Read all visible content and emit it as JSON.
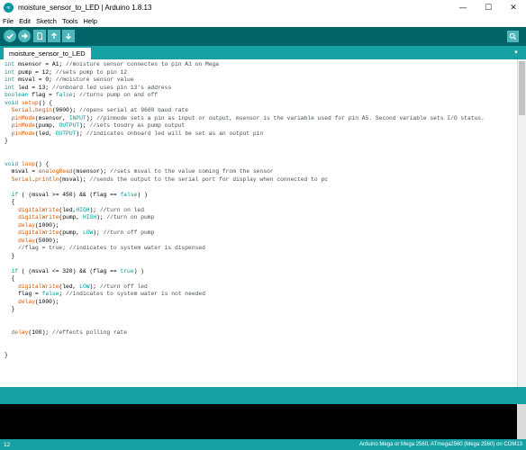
{
  "window": {
    "title": "moisture_sensor_to_LED | Arduino 1.8.13",
    "app_icon_glyph": "∞",
    "controls": {
      "minimize": "—",
      "maximize": "☐",
      "close": "✕"
    }
  },
  "menu": [
    "File",
    "Edit",
    "Sketch",
    "Tools",
    "Help"
  ],
  "toolbar": {
    "buttons": [
      "verify-icon",
      "upload-icon",
      "new-icon",
      "open-icon",
      "save-icon"
    ],
    "serial_monitor_icon": "magnifier-icon"
  },
  "tabs": {
    "active": "moisture_sensor_to_LED",
    "menu_glyph": "▾"
  },
  "code": [
    "int msensor = A1; //moisture sensor connectes to pin A1 on Mega",
    "int pump = 12; //sets pump to pin 12",
    "int msval = 0; //moisture sensor value",
    "int led = 13; //onboard led uses pin 13's address",
    "boolean flag = false; //turns pump on and off",
    "void setup() {",
    "  Serial.begin(9600); //opens serial at 9600 baud rate",
    "  pinMode(msensor, INPUT); //pinmode sets a pin as input or output, msensor is the variable used for pin A5. Second variable sets I/O status.",
    "  pinMode(pump, OUTPUT); //sets toodry as pump output",
    "  pinMode(led, OUTPUT); //indicates onboard led will be set as an output pin",
    "}",
    "",
    "",
    "void loop() {",
    "  msval = analogRead(msensor); //sets msval to the value coming from the sensor",
    "  Serial.println(msval); //sends the output to the serial port for display when connected to pc",
    "",
    "  if ( (msval >= 450) && (flag == false) )",
    "  {",
    "    digitalWrite(led,HIGH); //turn on led",
    "    digitalWrite(pump, HIGH); //turn on pump",
    "    delay(1000);",
    "    digitalWrite(pump, LOW); //turn off pump",
    "    delay(5000);",
    "    //flag = true; //indicates to system water is dispensed",
    "  }",
    "",
    "  if ( (msval <= 320) && (flag == true) )",
    "  {",
    "    digitalWrite(led, LOW); //turn off led",
    "    flag = false; //indicates to system water is not needed",
    "    delay(1000);",
    "  }",
    "",
    "",
    "  delay(100); //effects polling rate",
    "",
    "",
    "}"
  ],
  "status": {
    "line": "12",
    "board": "Arduino Mega or Mega 2560, ATmega2560 (Mega 2560) on COM13"
  },
  "colors": {
    "toolbar": "#006468",
    "accent": "#17a1a5",
    "keyword": "#00979c",
    "function": "#d35400",
    "comment": "#434f54"
  }
}
